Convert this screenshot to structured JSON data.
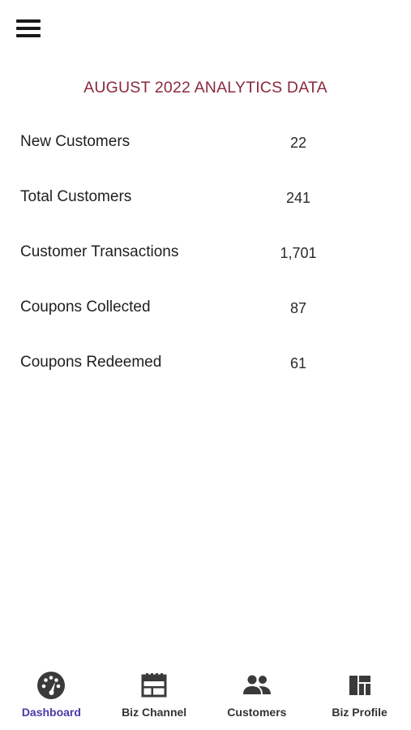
{
  "header": {
    "menu_icon": "hamburger-menu-icon",
    "title": "AUGUST 2022 ANALYTICS DATA"
  },
  "stats": [
    {
      "label": "New Customers",
      "value": "22"
    },
    {
      "label": "Total Customers",
      "value": "241"
    },
    {
      "label": "Customer Transactions",
      "value": "1,701"
    },
    {
      "label": "Coupons Collected",
      "value": "87"
    },
    {
      "label": "Coupons Redeemed",
      "value": "61"
    }
  ],
  "tabbar": {
    "active_color": "#4a3aa8",
    "tabs": [
      {
        "label": "Dashboard",
        "icon": "dashboard-gauge-icon",
        "active": true
      },
      {
        "label": "Biz Channel",
        "icon": "calendar-icon",
        "active": false
      },
      {
        "label": "Customers",
        "icon": "people-icon",
        "active": false
      },
      {
        "label": "Biz Profile",
        "icon": "grid-layout-icon",
        "active": false
      }
    ]
  },
  "colors": {
    "title": "#8a2a3c",
    "text": "#1f1f1f",
    "icon": "#3a3a3a"
  }
}
